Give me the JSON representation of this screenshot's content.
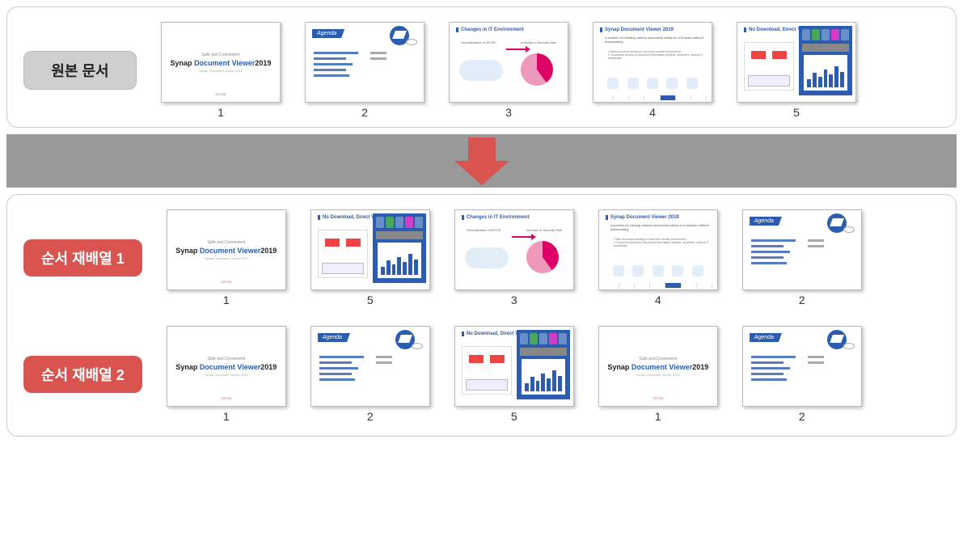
{
  "labels": {
    "original": "원본 문서",
    "reorder1": "순서 재배열 1",
    "reorder2": "순서 재배열 2"
  },
  "slide_types": {
    "title": {
      "pretitle": "Safe and Convenient",
      "main_prefix": "Synap",
      "main_blue": "Document Viewer",
      "main_year": "2019",
      "subtitle": "Synap Document Viewer 2019",
      "footer": "synap"
    },
    "agenda": {
      "header": "Agenda"
    },
    "itenv": {
      "title": "Changes in IT Environment",
      "left_label": "Generalization of BYOD",
      "right_label": "Increase in\nSecurity Risk"
    },
    "docviewer": {
      "title": "Synap Document Viewer 2019",
      "subtitle": "A solution for viewing various documents safely on a browser without downloading",
      "bullets": [
        "Safe document viewing in cloud and mobile environment",
        "Convenient access to document information anytime, anywhere, without IT knowledge"
      ]
    },
    "nodl": {
      "title": "No Download,\nDirect View"
    }
  },
  "rows": {
    "original": [
      {
        "type": "title",
        "num": "1"
      },
      {
        "type": "agenda",
        "num": "2"
      },
      {
        "type": "itenv",
        "num": "3"
      },
      {
        "type": "docviewer",
        "num": "4"
      },
      {
        "type": "nodl",
        "num": "5"
      }
    ],
    "reorder1": [
      {
        "type": "title",
        "num": "1"
      },
      {
        "type": "nodl",
        "num": "5"
      },
      {
        "type": "itenv",
        "num": "3"
      },
      {
        "type": "docviewer",
        "num": "4"
      },
      {
        "type": "agenda",
        "num": "2"
      }
    ],
    "reorder2": [
      {
        "type": "title",
        "num": "1"
      },
      {
        "type": "agenda",
        "num": "2"
      },
      {
        "type": "nodl",
        "num": "5"
      },
      {
        "type": "title",
        "num": "1"
      },
      {
        "type": "agenda",
        "num": "2"
      }
    ]
  }
}
